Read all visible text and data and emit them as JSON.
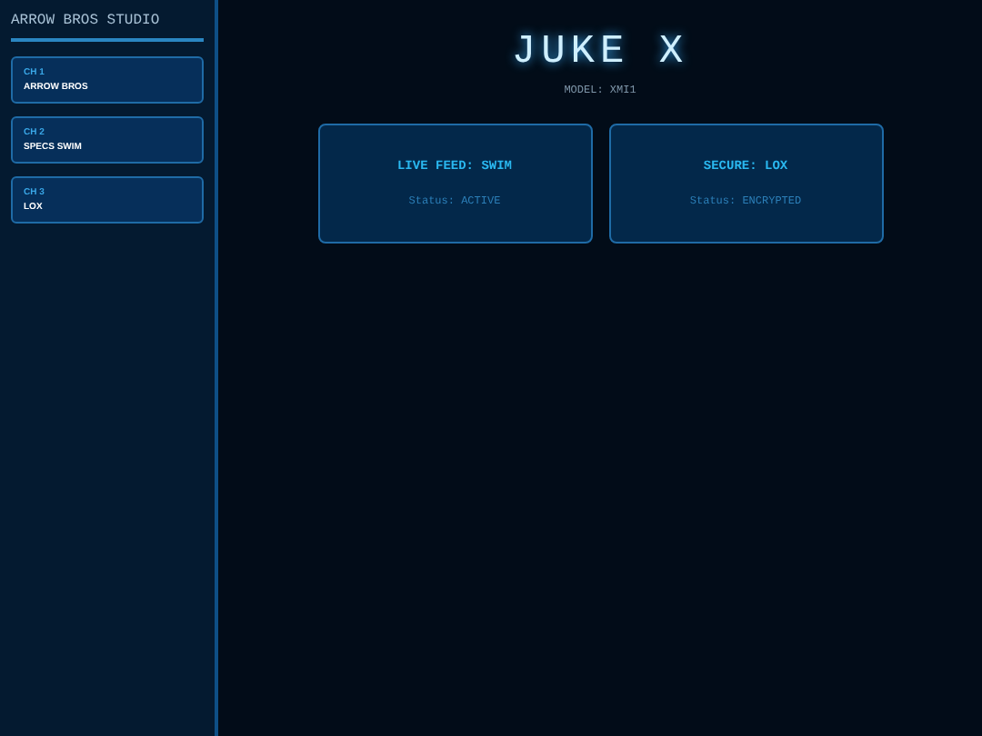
{
  "sidebar": {
    "title": "ARROW BROS STUDIO",
    "channels": [
      {
        "label": "CH 1",
        "name": "ARROW BROS"
      },
      {
        "label": "CH 2",
        "name": "SPECS SWIM"
      },
      {
        "label": "CH 3",
        "name": "LOX"
      }
    ]
  },
  "header": {
    "title": "JUKE X",
    "model": "MODEL: XMI1"
  },
  "cards": [
    {
      "title": "LIVE FEED: SWIM",
      "status": "Status: ACTIVE"
    },
    {
      "title": "SECURE: LOX",
      "status": "Status: ENCRYPTED"
    }
  ]
}
